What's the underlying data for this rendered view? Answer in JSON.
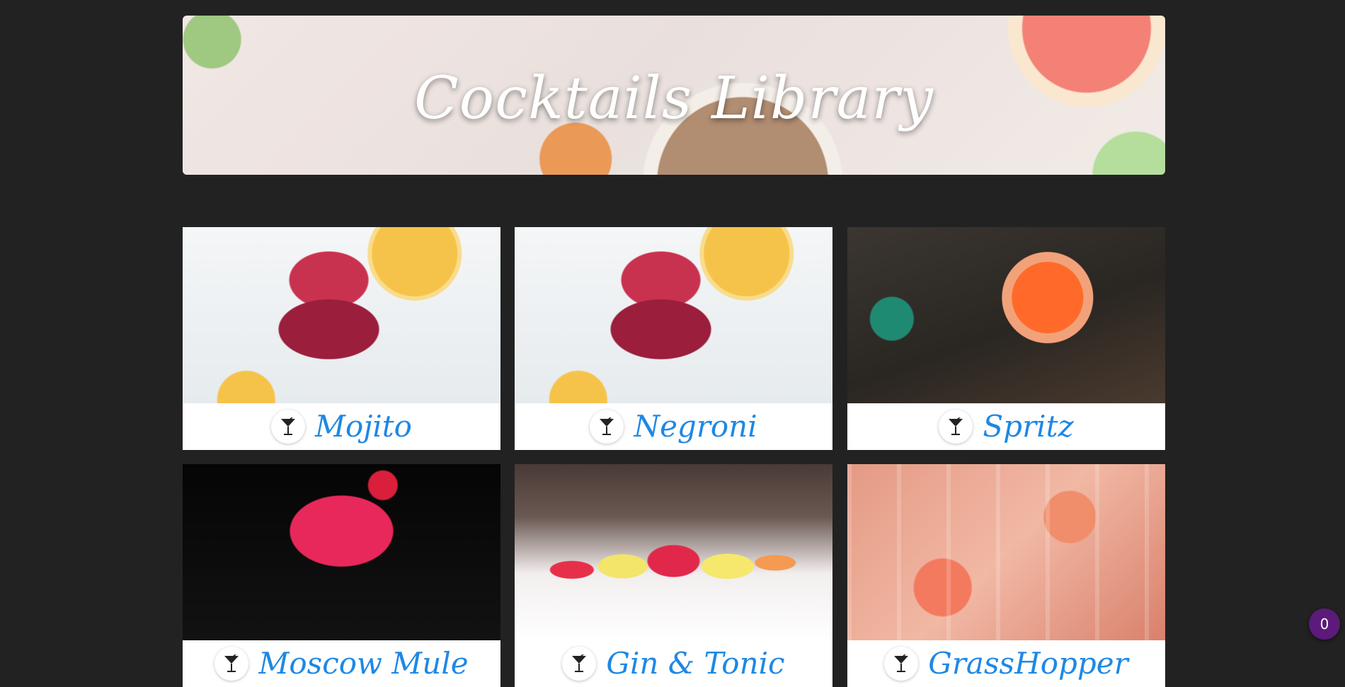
{
  "header": {
    "title": "Cocktails Library"
  },
  "cocktails": [
    {
      "name": "Mojito",
      "icon": "cocktail-glass-icon"
    },
    {
      "name": "Negroni",
      "icon": "cocktail-glass-icon"
    },
    {
      "name": "Spritz",
      "icon": "cocktail-glass-icon"
    },
    {
      "name": "Moscow Mule",
      "icon": "cocktail-glass-icon"
    },
    {
      "name": "Gin & Tonic",
      "icon": "cocktail-glass-icon"
    },
    {
      "name": "GrassHopper",
      "icon": "cocktail-glass-icon"
    }
  ],
  "badge": {
    "count": "0"
  },
  "colors": {
    "background": "#222222",
    "accent": "#1e88e5",
    "badge": "#5c1a7a"
  }
}
